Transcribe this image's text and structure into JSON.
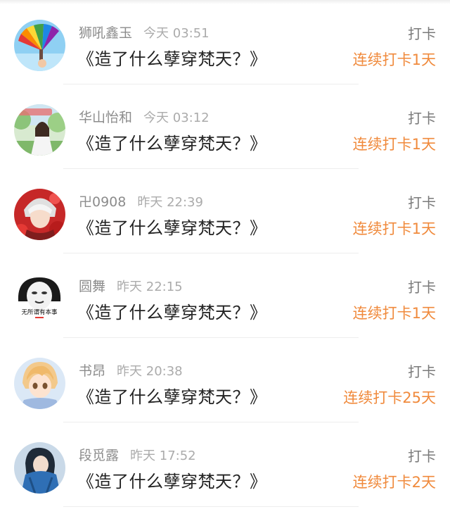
{
  "checkins": [
    {
      "user": "狮吼鑫玉",
      "time": "今天 03:51",
      "title": "《造了什么孽穿梵天？》",
      "action": "打卡",
      "streak": "连续打卡1天",
      "avatar_icon": "rainbow-fan-avatar-icon"
    },
    {
      "user": "华山怡和",
      "time": "今天 03:12",
      "title": "《造了什么孽穿梵天？》",
      "action": "打卡",
      "streak": "连续打卡1天",
      "avatar_icon": "girl-in-garden-avatar-icon"
    },
    {
      "user": "卍0908",
      "time": "昨天 22:39",
      "title": "《造了什么孽穿梵天？》",
      "action": "打卡",
      "streak": "连续打卡1天",
      "avatar_icon": "silver-hair-red-flowers-avatar-icon"
    },
    {
      "user": "圆舞",
      "time": "昨天 22:15",
      "title": "《造了什么孽穿梵天？》",
      "action": "打卡",
      "streak": "连续打卡1天",
      "avatar_icon": "meme-face-avatar-icon",
      "avatar_text": "无所谓有本事"
    },
    {
      "user": "书昂",
      "time": "昨天 20:38",
      "title": "《造了什么孽穿梵天？》",
      "action": "打卡",
      "streak": "连续打卡25天",
      "avatar_icon": "anime-boy-avatar-icon"
    },
    {
      "user": "段觅露",
      "time": "昨天 17:52",
      "title": "《造了什么孽穿梵天？》",
      "action": "打卡",
      "streak": "连续打卡2天",
      "avatar_icon": "blue-hoodie-girl-avatar-icon"
    }
  ],
  "colors": {
    "streak": "#f08a3c",
    "name": "#8c8c8c",
    "time": "#ababab",
    "title": "#222222",
    "action": "#7a7a7a"
  }
}
